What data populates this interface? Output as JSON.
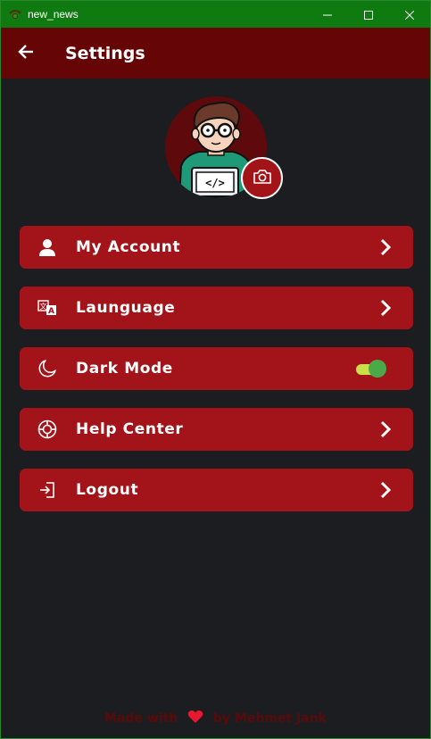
{
  "window": {
    "title": "new_news",
    "controls": [
      "minimize-icon",
      "maximize-icon",
      "close-icon"
    ]
  },
  "appbar": {
    "title": "Settings",
    "back_icon": "arrow-left-icon"
  },
  "profile": {
    "avatar": "developer-avatar",
    "camera_icon": "camera-icon"
  },
  "menu": {
    "items": [
      {
        "label": "My Account",
        "icon": "person-icon",
        "trailing": "chevron-right-icon"
      },
      {
        "label": "Launguage",
        "icon": "translate-icon",
        "trailing": "chevron-right-icon"
      },
      {
        "label": "Dark Mode",
        "icon": "moon-icon",
        "trailing": "toggle",
        "toggle_on": true
      },
      {
        "label": "Help Center",
        "icon": "lifebuoy-icon",
        "trailing": "chevron-right-icon"
      },
      {
        "label": "Logout",
        "icon": "logout-icon",
        "trailing": "chevron-right-icon"
      }
    ]
  },
  "footer": {
    "prefix": "Made with",
    "suffix": "by Mehmet Jank",
    "icon": "heart-icon"
  },
  "colors": {
    "titlebar": "#0f7a0f",
    "appbar": "#650505",
    "background": "#1b1d21",
    "menu_item": "#a3141a",
    "toggle_track": "#c9e04a",
    "toggle_thumb": "#4aaa4a",
    "heart": "#e8182e"
  }
}
